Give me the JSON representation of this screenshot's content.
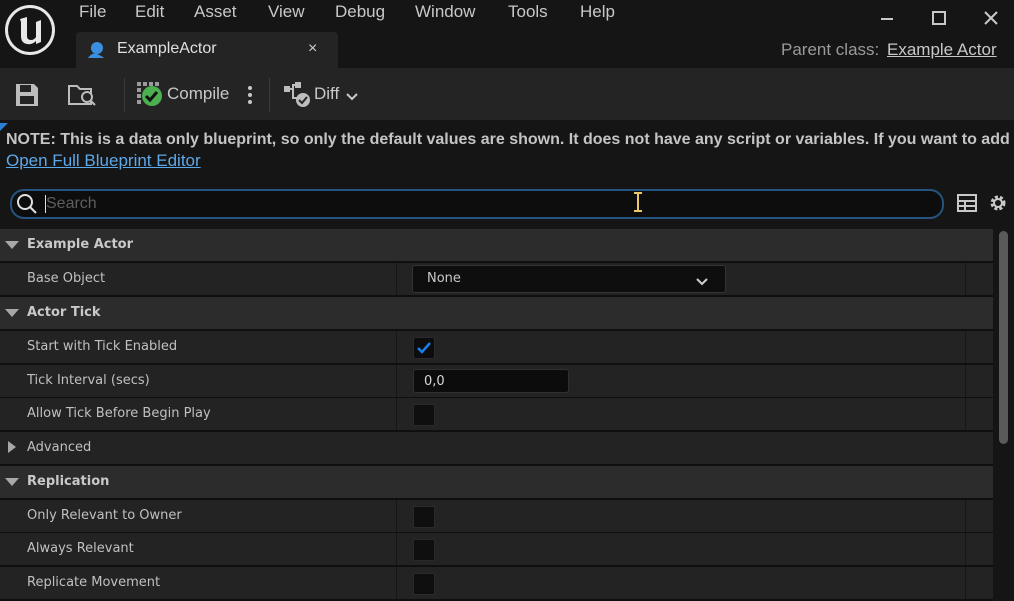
{
  "menu": {
    "items": [
      "File",
      "Edit",
      "Asset",
      "View",
      "Debug",
      "Window",
      "Tools",
      "Help"
    ]
  },
  "tab": {
    "title": "ExampleActor",
    "close": "×"
  },
  "parent_class": {
    "label": "Parent class:",
    "value": "Example Actor"
  },
  "toolbar": {
    "compile_label": "Compile",
    "diff_label": "Diff"
  },
  "notice": {
    "text": "NOTE: This is a data only blueprint, so only the default values are shown.  It does not have any script or variables.  If you want to add",
    "link": "Open Full Blueprint Editor"
  },
  "search": {
    "placeholder": "Search"
  },
  "details": {
    "cat_example_actor": "Example Actor",
    "base_object_label": "Base Object",
    "base_object_value": "None",
    "cat_actor_tick": "Actor Tick",
    "start_tick_label": "Start with Tick Enabled",
    "start_tick_checked": true,
    "tick_interval_label": "Tick Interval (secs)",
    "tick_interval_value": "0,0",
    "allow_tick_label": "Allow Tick Before Begin Play",
    "allow_tick_checked": false,
    "advanced_label": "Advanced",
    "cat_replication": "Replication",
    "only_relevant_label": "Only Relevant to Owner",
    "only_relevant_checked": false,
    "always_relevant_label": "Always Relevant",
    "always_relevant_checked": false,
    "replicate_movement_label": "Replicate Movement",
    "replicate_movement_checked": false
  },
  "colors": {
    "accent": "#0070e0",
    "link": "#5da8e8",
    "compile_ok": "#4caf50"
  }
}
